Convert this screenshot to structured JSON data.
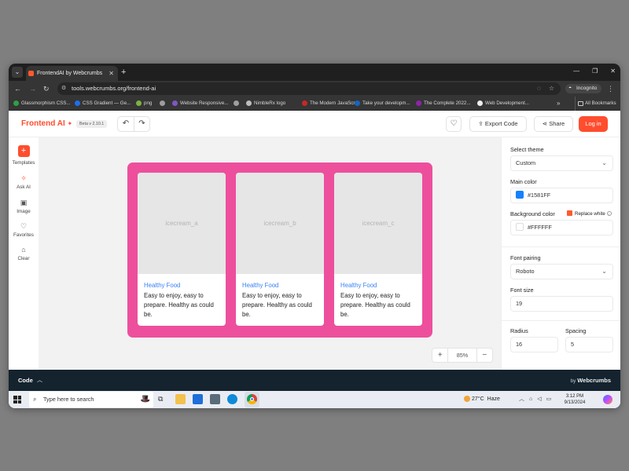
{
  "browser": {
    "tab_title": "FrontendAI by Webcrumbs",
    "url": "tools.webcrumbs.org/frontend-ai",
    "incognito_label": "Incognito",
    "bookmarks": [
      {
        "label": "Glassmorphism CSS...",
        "color": "#2ea043"
      },
      {
        "label": "CSS Gradient — Ge...",
        "color": "#1f6feb"
      },
      {
        "label": "png",
        "color": "#7cb342"
      },
      {
        "label": "",
        "color": "#9e9e9e"
      },
      {
        "label": "Website Responsive...",
        "color": "#7e57c2"
      },
      {
        "label": "",
        "color": "#9e9e9e"
      },
      {
        "label": "NimbleRx logo",
        "color": "#bdbdbd"
      },
      {
        "label": "The Modern JavaScr...",
        "color": "#c62828"
      },
      {
        "label": "Take your developm...",
        "color": "#1565c0"
      },
      {
        "label": "The Complete 2022...",
        "color": "#8e24aa"
      },
      {
        "label": "Web Development...",
        "color": "#eeeeee"
      }
    ],
    "all_bookmarks_label": "All Bookmarks"
  },
  "header": {
    "brand": "Frontend AI",
    "beta": "Beta v 2.10.1",
    "export_label": "Export Code",
    "share_label": "Share",
    "login_label": "Log in"
  },
  "sidebar": {
    "items": [
      {
        "label": "Templates"
      },
      {
        "label": "Ask AI"
      },
      {
        "label": "Image"
      },
      {
        "label": "Favorites"
      },
      {
        "label": "Clear"
      }
    ]
  },
  "canvas": {
    "frame_color": "#ED4F9D",
    "cards": [
      {
        "image_alt": "icecream_a",
        "label": "Healthy Food",
        "desc": "Easy to enjoy, easy to prepare. Healthy as could be."
      },
      {
        "image_alt": "icecream_b",
        "label": "Healthy Food",
        "desc": "Easy to enjoy, easy to prepare. Healthy as could be."
      },
      {
        "image_alt": "icecream_c",
        "label": "Healthy Food",
        "desc": "Easy to enjoy, easy to prepare. Healthy as could be."
      }
    ],
    "zoom": "85%"
  },
  "panel": {
    "theme_label": "Select theme",
    "theme_value": "Custom",
    "main_color_label": "Main color",
    "main_color_value": "#1581FF",
    "bg_color_label": "Background color",
    "replace_white_label": "Replace white",
    "bg_color_value": "#FFFFFF",
    "font_pairing_label": "Font pairing",
    "font_pairing_value": "Roboto",
    "font_size_label": "Font size",
    "font_size_value": "19",
    "radius_label": "Radius",
    "radius_value": "16",
    "spacing_label": "Spacing",
    "spacing_value": "5"
  },
  "codebar": {
    "label": "Code",
    "by": "by",
    "brand": "Webcrumbs"
  },
  "taskbar": {
    "search_placeholder": "Type here to search",
    "weather_temp": "27°C",
    "weather_desc": "Haze",
    "time": "3:12 PM",
    "date": "9/13/2024"
  }
}
